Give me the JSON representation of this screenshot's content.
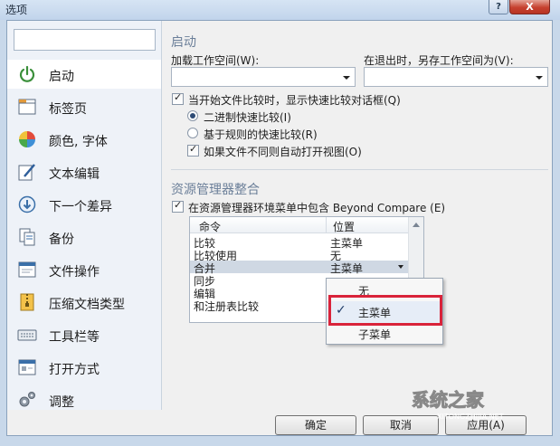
{
  "window": {
    "title": "选项",
    "help_label": "?",
    "close_label": "X"
  },
  "sidebar": {
    "search_placeholder": "",
    "items": [
      {
        "label": "启动",
        "icon": "power-icon"
      },
      {
        "label": "标签页",
        "icon": "tab-page-icon"
      },
      {
        "label": "颜色, 字体",
        "icon": "color-palette-icon"
      },
      {
        "label": "文本编辑",
        "icon": "text-edit-icon"
      },
      {
        "label": "下一个差异",
        "icon": "next-diff-icon"
      },
      {
        "label": "备份",
        "icon": "backup-icon"
      },
      {
        "label": "文件操作",
        "icon": "file-operations-icon"
      },
      {
        "label": "压缩文档类型",
        "icon": "archive-icon"
      },
      {
        "label": "工具栏等",
        "icon": "toolbar-keyboard-icon"
      },
      {
        "label": "打开方式",
        "icon": "open-with-icon"
      },
      {
        "label": "调整",
        "icon": "tweaks-gear-icon"
      }
    ],
    "active_index": 0
  },
  "startup": {
    "title": "启动",
    "load_workspace_label": "加载工作空间(W):",
    "load_workspace_value": "",
    "save_workspace_label": "在退出时，另存工作空间为(V):",
    "save_workspace_value": "",
    "quick_compare_check": {
      "label": "当开始文件比较时，显示快速比较对话框(Q)",
      "checked": true
    },
    "radio_binary": {
      "label": "二进制快速比较(I)",
      "selected": true
    },
    "radio_rules": {
      "label": "基于规则的快速比较(R)",
      "selected": false
    },
    "auto_open_check": {
      "label": "如果文件不同则自动打开视图(O)",
      "checked": true
    }
  },
  "explorer": {
    "title": "资源管理器整合",
    "include_check": {
      "label": "在资源管理器环境菜单中包含 Beyond Compare (E)",
      "checked": true
    },
    "columns": [
      "命令",
      "位置"
    ],
    "rows": [
      {
        "command": "比较",
        "location": "主菜单"
      },
      {
        "command": "比较使用",
        "location": "无"
      },
      {
        "command": "合并",
        "location": "主菜单"
      },
      {
        "command": "同步",
        "location": ""
      },
      {
        "command": "编辑",
        "location": ""
      },
      {
        "command": "和注册表比较",
        "location": ""
      }
    ],
    "selected_row": 2,
    "dropdown_options": [
      "无",
      "主菜单",
      "子菜单"
    ],
    "dropdown_selected": "主菜单"
  },
  "buttons": {
    "ok": "确定",
    "cancel": "取消",
    "apply": "应用(A)"
  },
  "watermark": {
    "text": "系统之家",
    "url": "XITONGZHIJIA.NET"
  }
}
